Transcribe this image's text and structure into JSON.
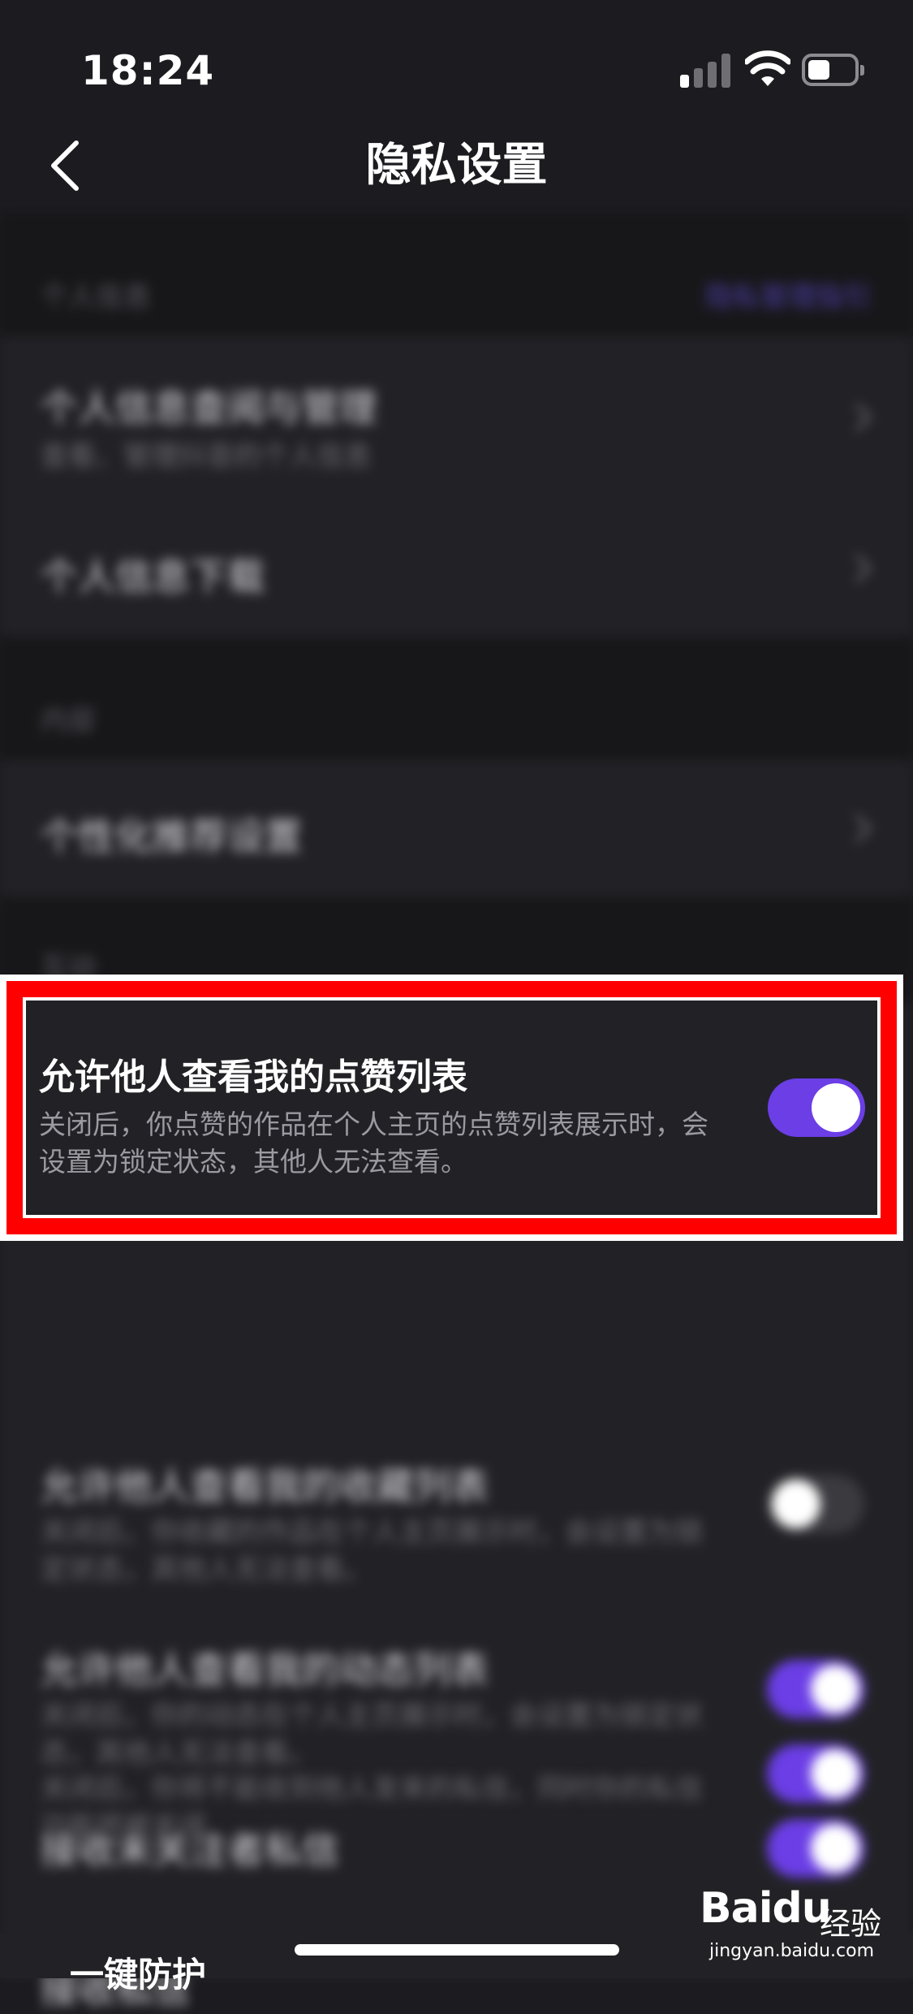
{
  "status_bar": {
    "time": "18:24"
  },
  "nav": {
    "title": "隐私设置"
  },
  "sections": [
    {
      "title": "个人信息",
      "action": "隐私管理指引"
    },
    {
      "title": "内容"
    },
    {
      "title": "互动"
    }
  ],
  "rows": {
    "personal_info_manage": {
      "title": "个人信息查阅与管理",
      "subtitle": "查看、管理抖音的个人信息"
    },
    "personal_info_download": {
      "title": "个人信息下载"
    },
    "personalized_recommend": {
      "title": "个性化推荐设置"
    },
    "like_list": {
      "title": "允许他人查看我的点赞列表",
      "description": "关闭后，你点赞的作品在个人主页的点赞列表展示时，会设置为锁定状态，其他人无法查看。",
      "enabled": true
    },
    "collection_list": {
      "title": "允许他人查看我的收藏列表",
      "subtitle": "关闭后，你收藏的作品在个人主页展示时，会设置为锁定状态，其他人无法查看。",
      "enabled": false
    },
    "dynamic_list": {
      "title": "允许他人查看我的动态列表",
      "subtitle": "关闭后，你的动态在个人主页展示时，会设置为锁定状态，其他人无法查看。",
      "enabled": true
    },
    "receive_unfollow_msg": {
      "title": "接收未关注者私信",
      "enabled": true
    },
    "receive_msg": {
      "title": "接收私信",
      "subtitle": "关闭后，你将不能收到他人发来的私信，同时你的私信功能将被关闭",
      "enabled": true
    }
  },
  "bottom_peek": "一键防护",
  "watermark": {
    "brand": "Baidu",
    "cn": "经验",
    "url": "jingyan.baidu.com"
  },
  "colors": {
    "accent": "#6b3ee6",
    "highlight": "#ff0000",
    "background": "#1c1c20"
  }
}
